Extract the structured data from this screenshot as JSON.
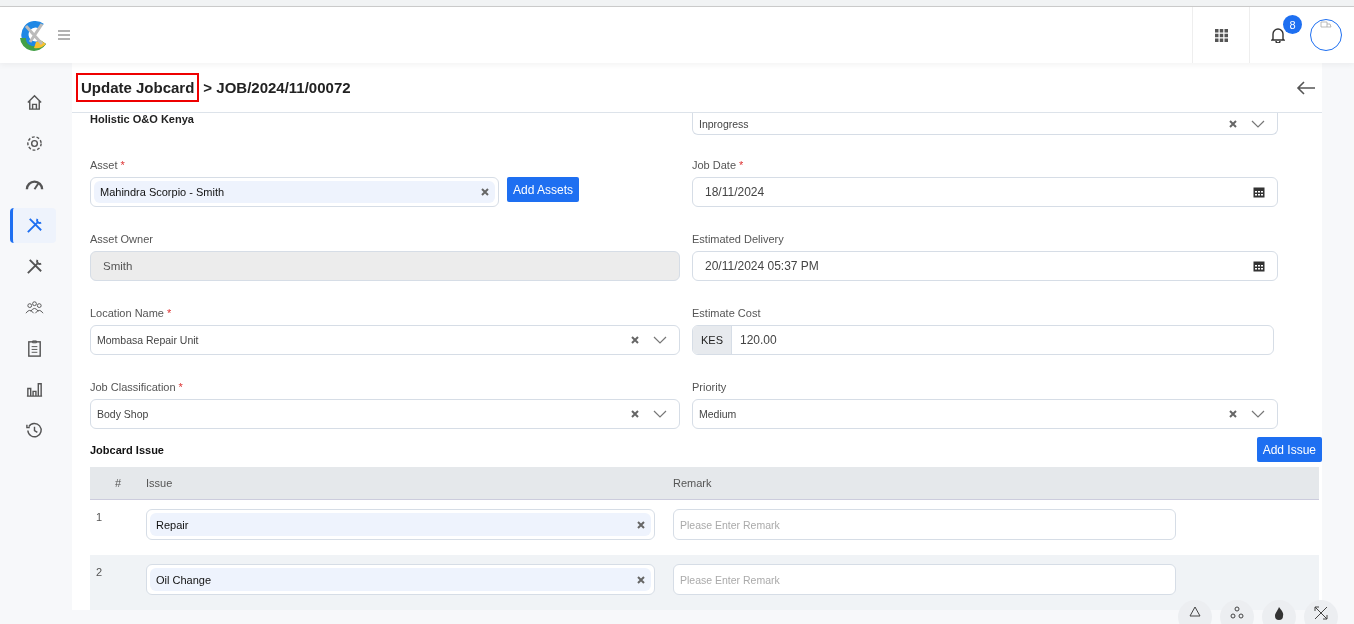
{
  "header": {
    "notification_count": "8"
  },
  "sidebar": {
    "items": [
      {
        "selected": false
      },
      {
        "selected": false
      },
      {
        "selected": false
      },
      {
        "selected": true
      },
      {
        "selected": false
      },
      {
        "selected": false
      },
      {
        "selected": false
      },
      {
        "selected": false
      },
      {
        "selected": false
      }
    ]
  },
  "page": {
    "title": "Update Jobcard",
    "breadcrumb": "> JOB/2024/11/00072"
  },
  "form": {
    "top_left_text": "Holistic O&O Kenya",
    "top_right_value": "Inprogress",
    "left_fields": [
      {
        "kind": "tag",
        "label": "Asset",
        "required_mark": "*",
        "value": "Mahindra Scorpio - Smith",
        "button": "Add Assets"
      },
      {
        "kind": "readonly",
        "label": "Asset Owner",
        "value": "Smith"
      },
      {
        "kind": "select",
        "label": "Location Name",
        "required_mark": "*",
        "value": "Mombasa Repair Unit"
      },
      {
        "kind": "select",
        "label": "Job Classification",
        "required_mark": "*",
        "value": "Body Shop"
      }
    ],
    "right_fields": [
      {
        "kind": "date",
        "label": "Job Date",
        "required_mark": "*",
        "value": "18/11/2024"
      },
      {
        "kind": "date",
        "label": "Estimated Delivery",
        "value": "20/11/2024 05:37 PM"
      },
      {
        "kind": "currency",
        "label": "Estimate Cost",
        "prefix": "KES",
        "value": "120.00"
      },
      {
        "kind": "select",
        "label": "Priority",
        "value": "Medium"
      }
    ]
  },
  "issues": {
    "title": "Jobcard Issue",
    "button": "Add Issue",
    "columns": [
      "#",
      "Issue",
      "Remark"
    ],
    "rows": [
      {
        "number": "1",
        "issue": "Repair",
        "remark_placeholder": "Please Enter Remark"
      },
      {
        "number": "2",
        "issue": "Oil Change",
        "remark_placeholder": "Please Enter Remark"
      }
    ]
  }
}
